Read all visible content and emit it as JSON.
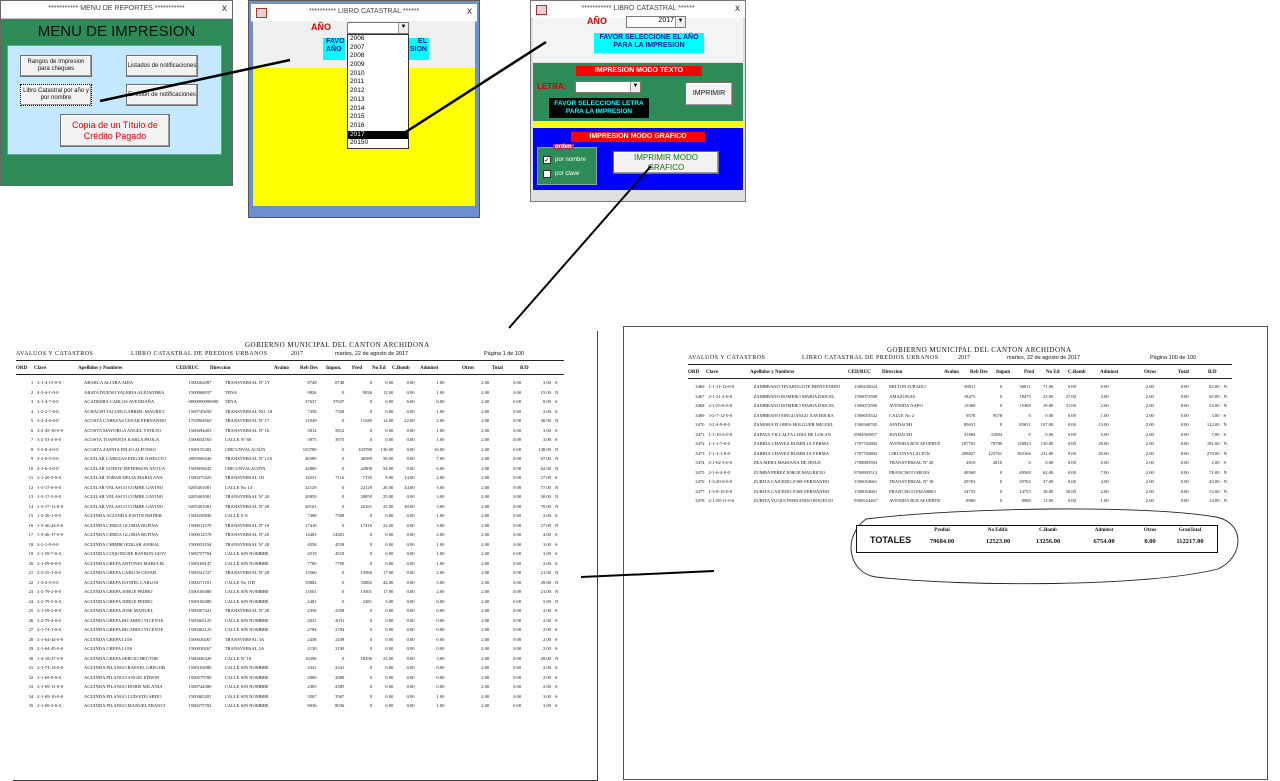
{
  "menu_window": {
    "title": "*********** MENU DE REPORTES ***********",
    "close_glyph": "x",
    "heading": "MENU DE IMPRESION",
    "buttons": {
      "rangos": "Rangos de Impresion para cheques",
      "listados": "Listados de notificaciones",
      "libro": "Libro Catastral por año y por nombre",
      "emision": "Emision de notificaciones",
      "copia": "Copia de un Título de Crédito Pagado"
    }
  },
  "year_window": {
    "title": "********** LIBRO CATASTRAL ******",
    "close_glyph": "x",
    "year_label": "AÑO",
    "selected_value": "",
    "banner_left": "FAVO",
    "banner_left2": "AÑO",
    "banner_right": "EL",
    "banner_right2": "SION",
    "years": [
      "2006",
      "2007",
      "2008",
      "2009",
      "2010",
      "2011",
      "2012",
      "2013",
      "2014",
      "2015",
      "2016",
      "2017",
      "20150"
    ],
    "highlighted_year": "2017"
  },
  "print_window": {
    "title": "*********** LIBRO CATASTRAL ******",
    "close_glyph": "x",
    "year_label": "AÑO",
    "year_value": "2017",
    "select_year_banner": "FAVOR SELECCIONE EL AÑO PARA LA IMPRESION",
    "text_mode_title": "IMPRESION MODO TEXTO",
    "letra_label": "LETRA:",
    "letra_value": "",
    "select_letter_banner": "FAVOR SELECCIONE LETRA PARA LA IMPRESION",
    "imprimir_label": "IMPRIMIR",
    "graphic_mode_title": "IMPRESION MODO GRAFICO",
    "orden_label": "orden",
    "por_nombre_label": "por nombre",
    "por_clave_label": "por clave",
    "imprimir_grafico_label": "IMPRIMIR MODO GRAFICO"
  },
  "report1": {
    "title": "GOBIERNO MUNICIPAL DEL CANTON ARCHIDONA",
    "dept": "AVALUOS Y CATASTROS",
    "book": "LIBRO CATASTRAL DE PREDIOS URBANOS",
    "year": "2017",
    "date": "martes, 22 de agosto de 2017",
    "page": "Página 1 de 100",
    "columns": [
      "ORD",
      "Clave",
      "Apellidos y Nombres",
      "CED/RUC",
      "Direccion",
      "Avaluo",
      "Reb Des",
      "Impon.",
      "Pred",
      "No Ed",
      "C.Bomb",
      "Adminst",
      "Otros",
      "Total",
      "R/D"
    ],
    "rows": [
      [
        "1",
        "3-1-4-15-0-0",
        "ABARCA ALCIRA AIDA",
        "1500262087",
        "TRANSVERSAL Nº 1Y",
        "8748",
        "8748",
        "0",
        "0.00",
        "0.00",
        "1.00",
        "2.00",
        "0.00",
        "3.00",
        "S"
      ],
      [
        "2",
        "4-3-4-1-0-0",
        "ABATA DUENO VALERIA ALEJANDRA",
        "1500868037",
        "TENA",
        "9826",
        "0",
        "9826",
        "12.00",
        "0.00",
        "1.00",
        "2.00",
        "0.00",
        "15.00",
        "N"
      ],
      [
        "3",
        "4-1-4-7-0-0",
        "ACADEMIA CARLOS AVENDAÑA",
        "0000000000000",
        "TENA",
        "37637",
        "37637",
        "0",
        "0.00",
        "6.00",
        "0.00",
        "2.00",
        "0.00",
        "8.00",
        "S"
      ],
      [
        "4",
        "1-2-2-7-0-0",
        "ACHACHI TACURI GABRIEL MAURICI",
        "1500745650",
        "TRANSVERSAL NO. 18",
        "7358",
        "7358",
        "0",
        "0.00",
        "0.00",
        "1.00",
        "2.00",
        "0.00",
        "3.00",
        "S"
      ],
      [
        "5",
        "3-2-4-6-0-0",
        "ACOSTA CABEZAS CESAR FERNANDO",
        "1703964565",
        "TRANSVERSAL Nº 17",
        "11049",
        "0",
        "11049",
        "14.00",
        "22.00",
        "2.00",
        "2.00",
        "0.00",
        "40.00",
        "N"
      ],
      [
        "6",
        "3-2-45-10-0-0",
        "ACOSTA MAYORGA ANGEL VINICIO",
        "1500494403",
        "TRANSVERSAL Nº 16",
        "5812",
        "5812",
        "0",
        "0.00",
        "0.00",
        "1.00",
        "2.00",
        "0.00",
        "3.00",
        "S"
      ],
      [
        "7",
        "3-2-53-4-0-0",
        "ACOSTA TOAPANTA KARLA PAOLA",
        "1500654765",
        "CALLE Nº 6E",
        "3975",
        "3975",
        "0",
        "0.00",
        "0.00",
        "1.00",
        "2.00",
        "0.00",
        "3.00",
        "S"
      ],
      [
        "8",
        "3-2-8-4-0-0",
        "ACOSTA ZAPATA FELIO ALFONSO",
        "1500155402",
        "CIRCUNVALACIÓN",
        "103780",
        "0",
        "103780",
        "130.00",
        "0.00",
        "16.00",
        "2.00",
        "0.00",
        "148.00",
        "N"
      ],
      [
        "9",
        "3-2-6-5-0-0",
        "AGUILAR CABEZAS EDGAR JOSELITO",
        "4985900446",
        "TRANSVERSAL Nº 12A",
        "46589",
        "0",
        "46589",
        "58.00",
        "0.00",
        "7.00",
        "2.00",
        "0.00",
        "67.00",
        "N"
      ],
      [
        "10",
        "4-1-6-3-0-0",
        "AGUILAR GODOY JEFFERSON ANTUA",
        "1500856045",
        "CIRCUNVALACIÓN",
        "42800",
        "0",
        "42800",
        "54.00",
        "0.00",
        "6.00",
        "2.00",
        "0.00",
        "62.00",
        "N"
      ],
      [
        "11",
        "2-1-20-3-0-0",
        "AGUILAR TOBAR DELIA MARIA ANA",
        "1500475425",
        "TRANSVERSAL 1D",
        "14251",
        "7116",
        "7135",
        "9.00",
        "14.00",
        "2.00",
        "2.00",
        "0.00",
        "27.00",
        "S"
      ],
      [
        "12",
        "1-3-17-6-0-0",
        "AGUILAR VELASCO COMBE GAVINO",
        "0205401081",
        "CALLE No 14",
        "22129",
        "0",
        "22129",
        "28.00",
        "44.00",
        "3.00",
        "2.00",
        "0.00",
        "77.00",
        "N"
      ],
      [
        "13",
        "1-3-17-5-0-0",
        "AGUILAR VELASCO COMBE GAVINO",
        "0205401081",
        "TRANSVERSAL Nº 20",
        "20859",
        "0",
        "20859",
        "25.00",
        "0.00",
        "3.00",
        "2.00",
        "0.00",
        "30.00",
        "N"
      ],
      [
        "14",
        "1-3-17-11-0-0",
        "AGUILAR VELASCO COMBE GAVINO",
        "0205401081",
        "TRANSVERSAL Nº 20",
        "20161",
        "0",
        "20161",
        "25.00",
        "40.00",
        "3.00",
        "2.00",
        "0.00",
        "70.00",
        "N"
      ],
      [
        "15",
        "1-3-26-1-0-0",
        "AGUINDA AGUINDA JOSTIN NEIDER",
        "1500250836",
        "CALLE S N",
        "7308",
        "7308",
        "0",
        "0.00",
        "0.00",
        "1.00",
        "2.00",
        "0.00",
        "3.00",
        "S"
      ],
      [
        "16",
        "1-3-46-24-0-0",
        "AGUINDA CERDA GLORIA RUFINA",
        "1500012570",
        "TRANSVERSAL Nº 18",
        "17410",
        "0",
        "17410",
        "22.00",
        "0.00",
        "3.00",
        "2.00",
        "0.00",
        "27.00",
        "N"
      ],
      [
        "17",
        "1-3-46-17-0-0",
        "AGUINDA CERDA GLORIA RUFINA",
        "1500012570",
        "TRANSVERSAL Nº 20",
        "14481",
        "14481",
        "0",
        "0.00",
        "0.00",
        "2.00",
        "2.00",
        "0.00",
        "4.00",
        "S"
      ],
      [
        "18",
        "2-2-1-9-0-0",
        "AGUINDA CHIMBO EDGAR ANIBAL",
        "1500052194",
        "TRANSVERSAL Nº 28",
        "4558",
        "4558",
        "0",
        "0.00",
        "0.00",
        "1.00",
        "2.00",
        "0.00",
        "3.00",
        "S"
      ],
      [
        "19",
        "2-1-59-7-0-0",
        "AGUINDA COQUINCHE BAYRON GIOV",
        "1500757784",
        "CALLE SIN NOMBRE",
        "4519",
        "4519",
        "0",
        "0.00",
        "0.00",
        "1.00",
        "2.00",
        "0.00",
        "3.00",
        "S"
      ],
      [
        "20",
        "2-1-59-6-0-0",
        "AGUINDA GREFA ANTONIA MARIA M",
        "1500169147",
        "CALLE SIN NOMBRE",
        "7700",
        "7700",
        "0",
        "0.00",
        "0.00",
        "1.00",
        "2.00",
        "0.00",
        "3.00",
        "S"
      ],
      [
        "21",
        "2-3-55-1-0-0",
        "AGUINDA GREFA CARLOS CESAR",
        "1500341727",
        "TRANSVERSAL Nº 20",
        "13560",
        "0",
        "13560",
        "17.00",
        "0.00",
        "2.00",
        "2.00",
        "0.00",
        "21.00",
        "N"
      ],
      [
        "22",
        "1-3-2-5-0-0",
        "AGUINDA GREFA DANIEL CARLOS",
        "1500271181",
        "CALLE No 11B",
        "33882",
        "0",
        "33882",
        "42.00",
        "0.00",
        "5.00",
        "2.00",
        "0.00",
        "49.00",
        "N"
      ],
      [
        "23",
        "2-2-79-2-0-0",
        "AGUINDA GREFA JORGE PEDRO",
        "1500100480",
        "CALLE SIN NOMBRE",
        "13501",
        "0",
        "13501",
        "17.00",
        "0.00",
        "2.00",
        "2.00",
        "0.00",
        "21.00",
        "N"
      ],
      [
        "24",
        "2-2-79-5-0-0",
        "AGUINDA GREFA JORGE PEDRO",
        "1500100480",
        "CALLE SIN NOMBRE",
        "2481",
        "0",
        "2481",
        "3.00",
        "0.00",
        "0.00",
        "2.00",
        "0.00",
        "5.00",
        "N"
      ],
      [
        "25",
        "2-1-59-2-0-0",
        "AGUINDA GREFA JOSE MANUEL",
        "1500307441",
        "TRANSVERSAL Nº 28",
        "2358",
        "2358",
        "0",
        "0.00",
        "0.00",
        "0.00",
        "2.00",
        "0.00",
        "2.00",
        "S"
      ],
      [
        "26",
        "2-2-79-4-0-0",
        "AGUINDA GREFA RICARDO VICENTE",
        "1500465125",
        "CALLE SIN NOMBRE",
        "2031",
        "2031",
        "0",
        "0.00",
        "0.00",
        "0.00",
        "2.00",
        "0.00",
        "2.00",
        "S"
      ],
      [
        "27",
        "2-1-74-1-0-0",
        "AGUINDA GREFA RICARDO VICENTE",
        "1500465125",
        "CALLE SIN NOMBRE",
        "2784",
        "2784",
        "0",
        "0.00",
        "0.00",
        "0.00",
        "2.00",
        "0.00",
        "2.00",
        "S"
      ],
      [
        "28",
        "2-1-64-44-0-0",
        "AGUINDA GREFA LUIS",
        "1500030267",
        "TRANSVERSAL 3A",
        "2438",
        "2438",
        "0",
        "0.00",
        "0.00",
        "0.00",
        "2.00",
        "0.00",
        "2.00",
        "S"
      ],
      [
        "29",
        "2-1-64-45-0-0",
        "AGUINDA GREFA LUIS",
        "1500030267",
        "TRANSVERSAL 3A",
        "2130",
        "2130",
        "0",
        "0.00",
        "0.00",
        "0.00",
        "2.00",
        "0.00",
        "2.00",
        "S"
      ],
      [
        "30",
        "1-4-18-27-0-0",
        "AGUINDA GREFA SERGIO HECTOR",
        "1500446320",
        "CALLE Nº 18",
        "18296",
        "0",
        "18296",
        "23.00",
        "0.00",
        "3.00",
        "2.00",
        "0.00",
        "28.00",
        "N"
      ],
      [
        "31",
        "2-1-74-14-0-0",
        "AGUINDA PILANGO RAFAEL GREGOR",
        "1500102080",
        "CALLE SIN NOMBRE",
        "2341",
        "2341",
        "0",
        "0.00",
        "0.00",
        "0.00",
        "2.00",
        "0.00",
        "2.00",
        "S"
      ],
      [
        "32",
        "2-1-69-9-0-0",
        "AGUINDA PILANGO ANGEL EDWIN",
        "1500579789",
        "CALLE SIN NOMBRE",
        "2000",
        "2000",
        "0",
        "0.00",
        "0.00",
        "0.00",
        "2.00",
        "0.00",
        "2.00",
        "S"
      ],
      [
        "33",
        "2-1-69-11-0-0",
        "AGUINDA PILANGO DORIS MILANIA",
        "1500744380",
        "CALLE SIN NOMBRE",
        "2385",
        "2385",
        "0",
        "0.00",
        "0.00",
        "0.00",
        "2.00",
        "0.00",
        "2.00",
        "S"
      ],
      [
        "34",
        "2-1-69-10-0-0",
        "AGUINDA PILANGO LUIS EDUARDO",
        "1500465281",
        "CALLE SIN NOMBRE",
        "3567",
        "3567",
        "0",
        "0.00",
        "0.00",
        "1.00",
        "2.00",
        "0.00",
        "3.00",
        "S"
      ],
      [
        "35",
        "2-1-69-2-0-0",
        "AGUINDA PILANGO MANUEL FRANCI",
        "1500275782",
        "CALLE SIN NOMBRE",
        "8036",
        "8036",
        "0",
        "0.00",
        "0.00",
        "1.00",
        "2.00",
        "0.00",
        "3.00",
        "S"
      ]
    ]
  },
  "report2": {
    "title": "GOBIERNO MUNICIPAL DEL CANTON ARCHIDONA",
    "dept": "AVALUOS Y CATASTROS",
    "book": "LIBRO CATASTRAL DE PREDIOS URBANOS",
    "year": "2017",
    "date": "martes, 22 de agosto de 2017",
    "page": "Página 100 de 100",
    "columns": [
      "ORD",
      "Clave",
      "Apellidos y Nombres",
      "CED/RUC",
      "Direccion",
      "Avaluo",
      "Reb Des",
      "Impon",
      "Pred",
      "No Ed",
      "C.Bomb",
      "Adminst",
      "Otros",
      "Total",
      "R/D"
    ],
    "rows": [
      [
        "3469",
        "1-1-11-12-0-0",
        "ZAMBRANO TINAROGOTE BIENVENIDO",
        "1500445024",
        "MILTON JURADO",
        "36811",
        "0",
        "36811",
        "71.00",
        "0.00",
        "0.00",
        "2.00",
        "0.00",
        "82.00",
        "N"
      ],
      [
        "3467",
        "2-1-21-2-0-0",
        "ZAMBRANO ROMERO MARIA DIOCEL",
        "1500072580",
        "AMAZONAS",
        "18475",
        "0",
        "18475",
        "23.00",
        "37.00",
        "3.00",
        "2.00",
        "0.00",
        "65.00",
        "N"
      ],
      [
        "3468",
        "2-1-55-6-0-0",
        "ZAMBRANO ROMERO MARIA DIOCEL",
        "1500072580",
        "AVENIDA NAPO",
        "15369",
        "0",
        "15369",
        "19.00",
        "31.00",
        "2.00",
        "2.00",
        "0.00",
        "54.00",
        "N"
      ],
      [
        "3469",
        "3-2-7-12-0-0",
        "ZAMBRANO SINGUANGO XAVIER RA",
        "1500653542",
        "CALLE No 2",
        "9578",
        "9578",
        "0",
        "0.00",
        "0.00",
        "1.00",
        "2.00",
        "0.00",
        "3.00",
        "S"
      ],
      [
        "3470",
        "3-2-4-9-0-0",
        "ZAMORA FLORES HOLGUER MIGUEL",
        "1500568765",
        "JONDACHI",
        "85651",
        "0",
        "85651",
        "107.00",
        "0.00",
        "13.00",
        "2.00",
        "0.00",
        "122.00",
        "N"
      ],
      [
        "3471",
        "1-1-29-4-0-0",
        "ZAPATA VILLALTA LIDIA DE LOS AN",
        "0904565857",
        "JONDACHI",
        "31884",
        "31884",
        "0",
        "0.00",
        "0.00",
        "5.00",
        "2.00",
        "0.00",
        "7.00",
        "S"
      ],
      [
        "3472",
        "1-1-1-7-0-0",
        "ZARRIA CHAVEZ RUMELIA YERMA",
        "1707702882",
        "AVENIDA ROCAFUERTE",
        "187702",
        "78789",
        "128923",
        "130.00",
        "0.00",
        "28.00",
        "2.00",
        "0.00",
        "181.00",
        "N"
      ],
      [
        "3473",
        "1-1-3-1-0-0",
        "ZARRIA CHAVEZ RUMELIA YERMA",
        "1707702882",
        "CIRCUNVALACIÓN",
        "208827",
        "125761",
        "183166",
        "231.00",
        "0.00",
        "45.00",
        "2.00",
        "0.00",
        "278.00",
        "N"
      ],
      [
        "3474",
        "2-1-62-3-0-0",
        "ZEA MERA MARIANA DE JESUS",
        "1708883583",
        "TRANSVERSAL Nº 28",
        "2810",
        "2810",
        "0",
        "0.00",
        "0.00",
        "0.00",
        "2.00",
        "0.00",
        "2.00",
        "S"
      ],
      [
        "3475",
        "2-1-6-4-0-0",
        "ZUMBA PEREZ JORGE MAURICIO",
        "0700905512",
        "FRANCISCO MEJIA",
        "49569",
        "0",
        "49569",
        "62.00",
        "0.00",
        "7.00",
        "2.00",
        "0.00",
        "71.00",
        "N"
      ],
      [
        "3476",
        "1-3-20-9-0-0",
        "ZURITA CAICEDO JOSE FERNANDO",
        "1500054661",
        "TRANSVERSAL Nº 18",
        "29763",
        "0",
        "29763",
        "37.00",
        "0.00",
        "4.00",
        "2.00",
        "0.00",
        "43.00",
        "N"
      ],
      [
        "3477",
        "1-3-8-10-0-0",
        "ZURITA CAICEDO JOSE FERNANDO",
        "1500054661",
        "FRANCISCO PIZARRO",
        "14755",
        "0",
        "14755",
        "18.00",
        "30.00",
        "2.00",
        "2.00",
        "0.00",
        "52.00",
        "N"
      ],
      [
        "3478",
        "2-1-58-11-0-0",
        "ZURITA YUQUI FERNANDO ROGELIO",
        "0500524467",
        "AVENIDA ROCAFUERTE",
        "8960",
        "0",
        "8960",
        "11.00",
        "0.00",
        "1.00",
        "2.00",
        "0.00",
        "14.00",
        "N"
      ]
    ],
    "totals": {
      "label": "TOTALES",
      "headers": [
        "Predial",
        "No Edific",
        "C.Bomb",
        "Adminst",
        "Otros",
        "GranTotal"
      ],
      "values": [
        "79684.00",
        "12523.00",
        "13256.00",
        "6754.00",
        "0.00",
        "112217.00"
      ]
    }
  },
  "colors": {
    "menu_bg": "#2e8b57",
    "yellow": "#ffff00",
    "cyan": "#00ffff",
    "red": "#ff0000",
    "blue": "#0000ff",
    "window_blue": "#6c8fd0"
  }
}
